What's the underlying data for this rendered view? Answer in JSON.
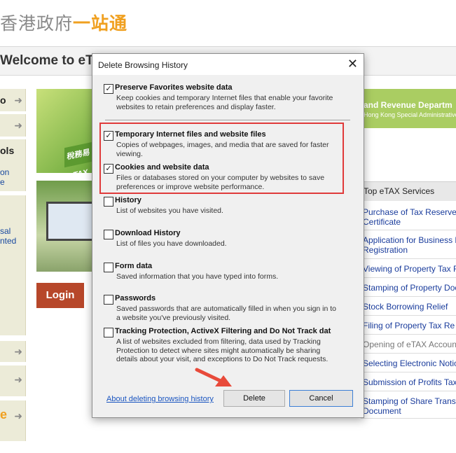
{
  "page": {
    "gov_logo_grey": "香港政府",
    "gov_logo_orange": "一站通",
    "welcome": "Welcome to eTA",
    "left_sidebar": {
      "item1": "o",
      "tools_label": "ols",
      "tools_link1": "on",
      "tools_link2": "e",
      "link_a": "sal",
      "link_b": "nted",
      "bottom_text": "e"
    },
    "banner_label": "稅務易 eTAX",
    "login_button": "Login",
    "revenue_title": "and Revenue Departm",
    "revenue_sub": "Hong Kong Special Administrative R",
    "top_services_title": "Top eTAX Services",
    "services": [
      {
        "line1": "Purchase of Tax Reserve",
        "line2": "Certificate"
      },
      {
        "line1": "Application for Business R",
        "line2": "Registration"
      },
      {
        "line1": "Viewing of Property Tax R",
        "line2": ""
      },
      {
        "line1": "Stamping of Property Doc",
        "line2": ""
      },
      {
        "line1": "Stock Borrowing Relief",
        "line2": ""
      },
      {
        "line1": "Filing of Property Tax Re",
        "line2": ""
      },
      {
        "line1": "Opening of eTAX Accoun",
        "line2": ""
      },
      {
        "line1": "Selecting Electronic Notic",
        "line2": ""
      },
      {
        "line1": "Submission of Profits Tax",
        "line2": ""
      },
      {
        "line1": "Stamping of Share Trans",
        "line2": "Document"
      }
    ]
  },
  "dialog": {
    "title": "Delete Browsing History",
    "close_glyph": "✕",
    "options": [
      {
        "label": "Preserve Favorites website data",
        "desc": "Keep cookies and temporary Internet files that enable your favorite websites to retain preferences and display faster.",
        "checked": true
      },
      {
        "label": "Temporary Internet files and website files",
        "desc": "Copies of webpages, images, and media that are saved for faster viewing.",
        "checked": true
      },
      {
        "label": "Cookies and website data",
        "desc": "Files or databases stored on your computer by websites to save preferences or improve website performance.",
        "checked": true
      },
      {
        "label": "History",
        "desc": "List of websites you have visited.",
        "checked": false
      },
      {
        "label": "Download History",
        "desc": "List of files you have downloaded.",
        "checked": false
      },
      {
        "label": "Form data",
        "desc": "Saved information that you have typed into forms.",
        "checked": false
      },
      {
        "label": "Passwords",
        "desc": "Saved passwords that are automatically filled in when you sign in to a website you've previously visited.",
        "checked": false
      },
      {
        "label": "Tracking Protection, ActiveX Filtering and Do Not Track dat",
        "desc": "A list of websites excluded from filtering, data used by Tracking Protection to detect where sites might automatically be sharing details about your visit, and exceptions to Do Not Track requests.",
        "checked": false
      }
    ],
    "about_link": "About deleting browsing history",
    "delete_button": "Delete",
    "cancel_button": "Cancel"
  },
  "colors": {
    "highlight_box": "#e03a3a",
    "annotation_arrow": "#e84a3a",
    "login_button": "#b7472a",
    "revenue_bar": "#aacd62",
    "link": "#1a55c0"
  }
}
